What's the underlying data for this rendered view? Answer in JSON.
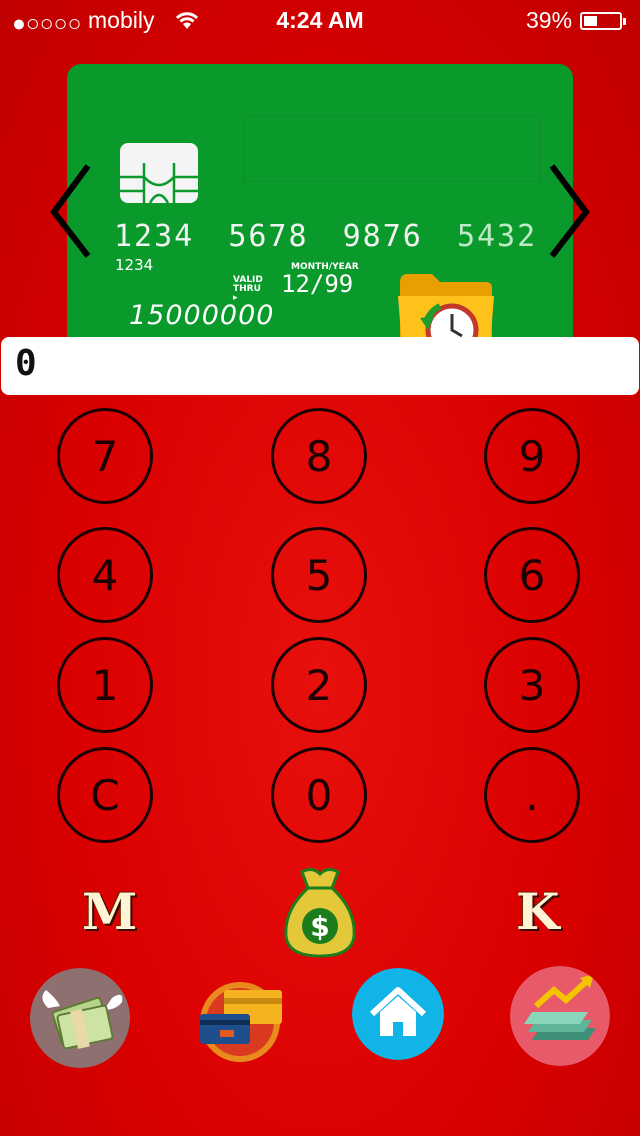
{
  "status_bar": {
    "signal": "●○○○○",
    "carrier": "mobily",
    "time": "4:24 AM",
    "battery_percent": "39%",
    "battery_level": 0.39
  },
  "card": {
    "number_groups": [
      "1234",
      "5678",
      "9876",
      "5432"
    ],
    "small_number": "1234",
    "valid_thru_label": "VALID THRU",
    "month_year_label": "MONTH/YEAR",
    "expiry": "12/99",
    "balance": "15000000",
    "background_color": "#0a9a2c"
  },
  "display": {
    "value": "0"
  },
  "keypad": {
    "rows": [
      [
        "7",
        "8",
        "9"
      ],
      [
        "4",
        "5",
        "6"
      ],
      [
        "1",
        "2",
        "3"
      ],
      [
        "C",
        "0",
        "."
      ]
    ]
  },
  "bottom": {
    "left_letter": "M",
    "right_letter": "K",
    "center_icon": "money-bag-icon"
  },
  "tabbar": {
    "icons": [
      "flying-money-icon",
      "cards-wallet-icon",
      "home-icon",
      "money-growth-icon"
    ]
  },
  "colors": {
    "background": "#d90000",
    "home_button": "#10b4e6",
    "growth_button": "#e85a6a",
    "money_button": "#8f7070"
  }
}
